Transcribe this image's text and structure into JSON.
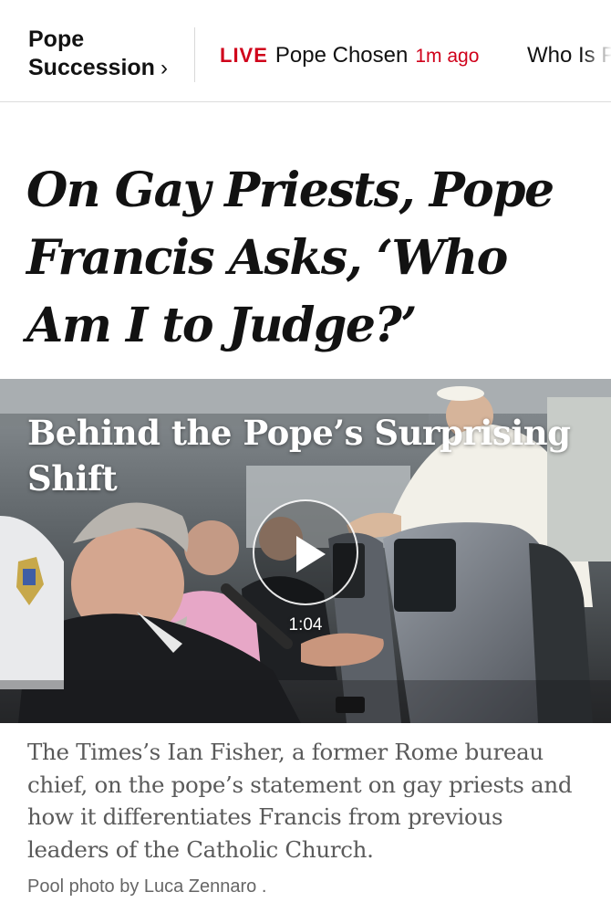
{
  "nav": {
    "section_line1": "Pope",
    "section_line2": "Succession",
    "section_chevron": "›",
    "live_badge": "LIVE",
    "live_title": "Pope Chosen",
    "live_time": "1m ago",
    "next_item": "Who Is P"
  },
  "article": {
    "headline": "On Gay Priests, Pope Francis Asks, ‘Who Am I to Judge?’"
  },
  "video": {
    "title": "Behind the Pope’s Surprising Shift",
    "duration": "1:04",
    "play_icon": "play-icon"
  },
  "caption": {
    "text": "The Times’s Ian Fisher, a former Rome bureau chief, on the pope’s statement on gay priests and how it differentiates Francis from previous leaders of the Catholic Church.",
    "credit": "Pool photo by Luca Zennaro ."
  },
  "colors": {
    "live_red": "#d0021b",
    "text": "#121212",
    "caption_gray": "#5a5a5a"
  }
}
